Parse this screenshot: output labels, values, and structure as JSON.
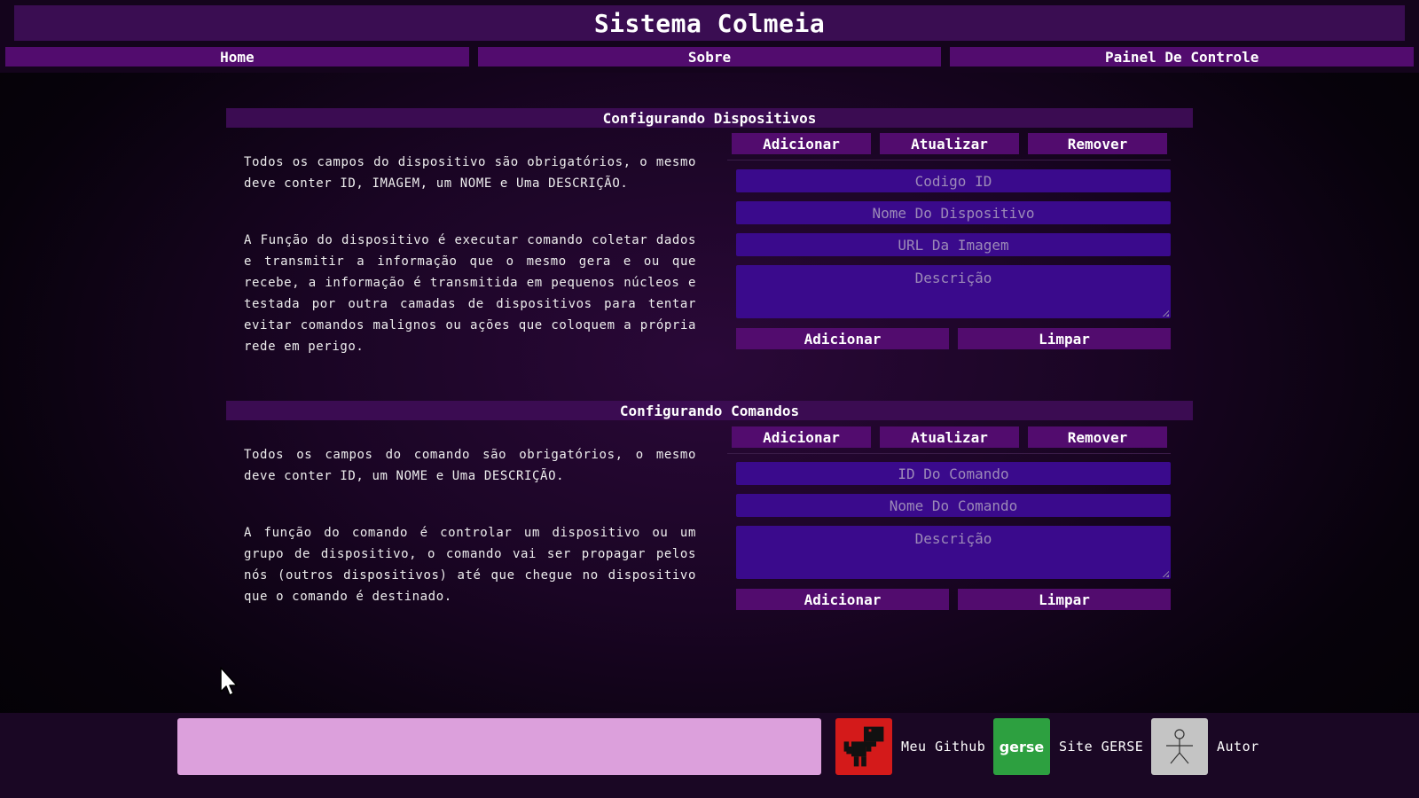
{
  "header": {
    "title": "Sistema Colmeia"
  },
  "nav": {
    "items": [
      {
        "label": "Home"
      },
      {
        "label": "Sobre"
      },
      {
        "label": "Painel De Controle"
      }
    ]
  },
  "devices": {
    "title": "Configurando Dispositivos",
    "tabs": {
      "add": "Adicionar",
      "update": "Atualizar",
      "remove": "Remover"
    },
    "paragraph1": "Todos os campos do dispositivo são obrigatórios, o mesmo deve conter ID, IMAGEM, um NOME e Uma DESCRIÇÃO.",
    "paragraph2": "A Função do dispositivo é executar comando coletar dados e transmitir a informação que o mesmo gera e ou que recebe, a informação é transmitida em pequenos núcleos e testada por outra camadas de dispositivos para tentar evitar comandos malignos ou ações que coloquem a própria rede em perigo.",
    "form": {
      "id_placeholder": "Codigo ID",
      "name_placeholder": "Nome Do Dispositivo",
      "image_placeholder": "URL Da Imagem",
      "desc_placeholder": "Descrição",
      "submit": "Adicionar",
      "clear": "Limpar"
    }
  },
  "commands": {
    "title": "Configurando Comandos",
    "tabs": {
      "add": "Adicionar",
      "update": "Atualizar",
      "remove": "Remover"
    },
    "paragraph1": "Todos os campos do comando são obrigatórios, o mesmo deve conter ID, um NOME e Uma DESCRIÇÃO.",
    "paragraph2": "A função do comando é controlar um dispositivo ou um grupo de dispositivo, o comando vai ser propagar pelos nós (outros dispositivos) até que chegue no dispositivo que o comando é destinado.",
    "form": {
      "id_placeholder": "ID Do Comando",
      "name_placeholder": "Nome Do Comando",
      "desc_placeholder": "Descrição",
      "submit": "Adicionar",
      "clear": "Limpar"
    }
  },
  "footer": {
    "links": [
      {
        "label": "Meu Github",
        "icon": "dino-icon"
      },
      {
        "label": "Site GERSE",
        "icon": "gerse-logo-icon"
      },
      {
        "label": "Autor",
        "icon": "stick-figure-icon"
      }
    ],
    "gerse_logo_text": "gerse",
    "colors": {
      "input_bg": "#dca0dc",
      "accent": "#520c6e",
      "field_bg": "#3a0a8c"
    }
  }
}
